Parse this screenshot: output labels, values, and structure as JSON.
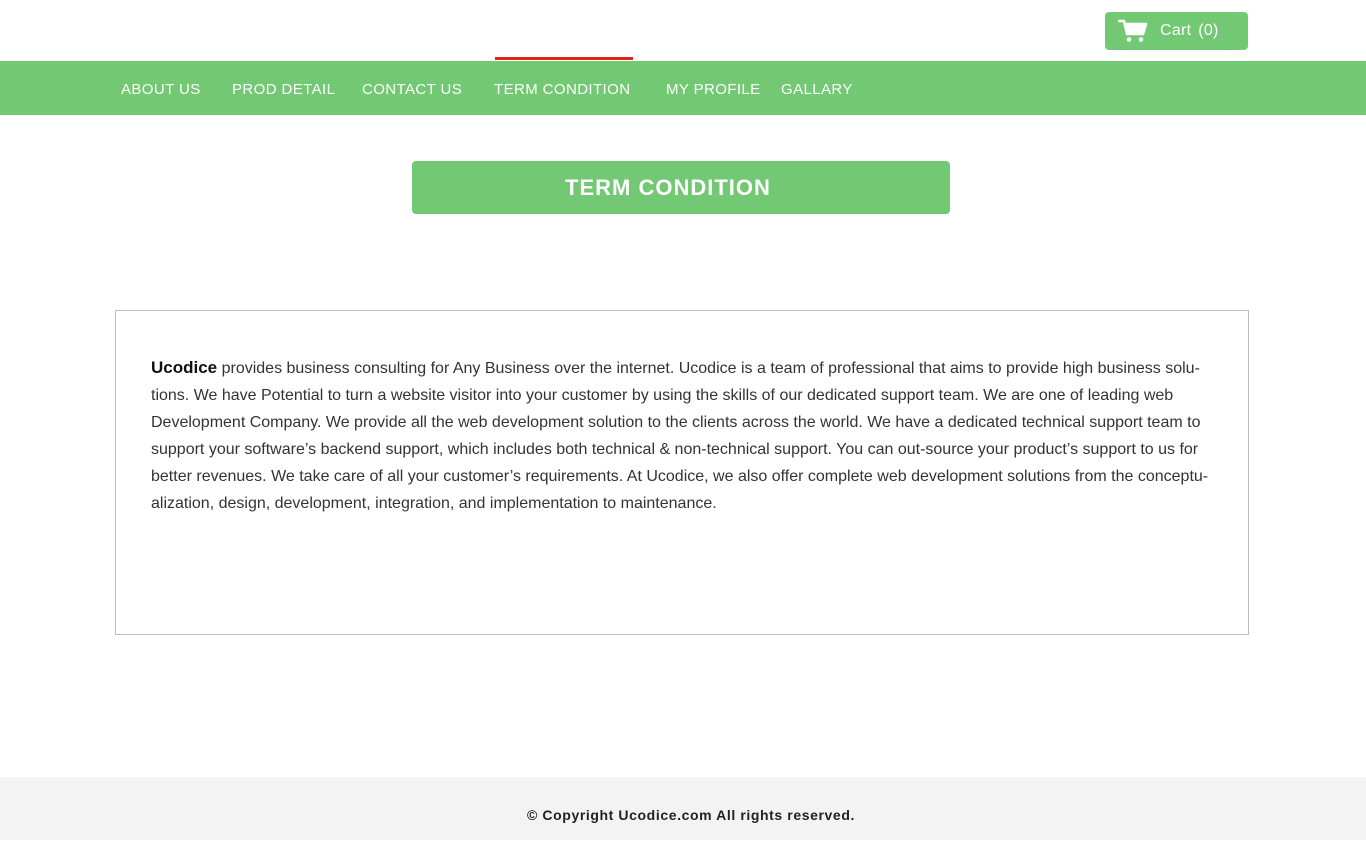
{
  "header": {
    "cart": {
      "icon": "shopping-cart-icon",
      "label": "Cart",
      "count_text": "(0)"
    }
  },
  "nav": {
    "items": [
      {
        "label": "ABOUT US"
      },
      {
        "label": "PROD DETAIL"
      },
      {
        "label": "CONTACT US"
      },
      {
        "label": "TERM CONDITION"
      },
      {
        "label": "MY PROFILE"
      },
      {
        "label": "GALLARY"
      }
    ],
    "active": "TERM CONDITION"
  },
  "page": {
    "title": "TERM CONDITION",
    "brand": "Ucodice",
    "body": " provides business consulting for Any Business over the internet. Ucodice is a team of professional that aims to provide high business solu­tions. We have Potential to turn a website visitor into your customer by using the skills of our dedicated support team. We are one of leading web Development Company. We provide all the web development solution to the clients across the world.  We have a dedicated technical support team to support your software’s backend support, which includes both technical & non-technical support.  You can out-source your product’s support to us for better revenues. We take care of all your customer’s requirements.  At Ucodice, we also offer complete web development solutions from the conceptu­alization, design, development, integration, and implementation to maintenance."
  },
  "footer": {
    "copyright": "© Copyright Ucodice.com All rights reserved."
  },
  "colors": {
    "brand_green": "#73c874",
    "active_underline": "#e0211c",
    "footer_bg": "#f3f3f3"
  }
}
